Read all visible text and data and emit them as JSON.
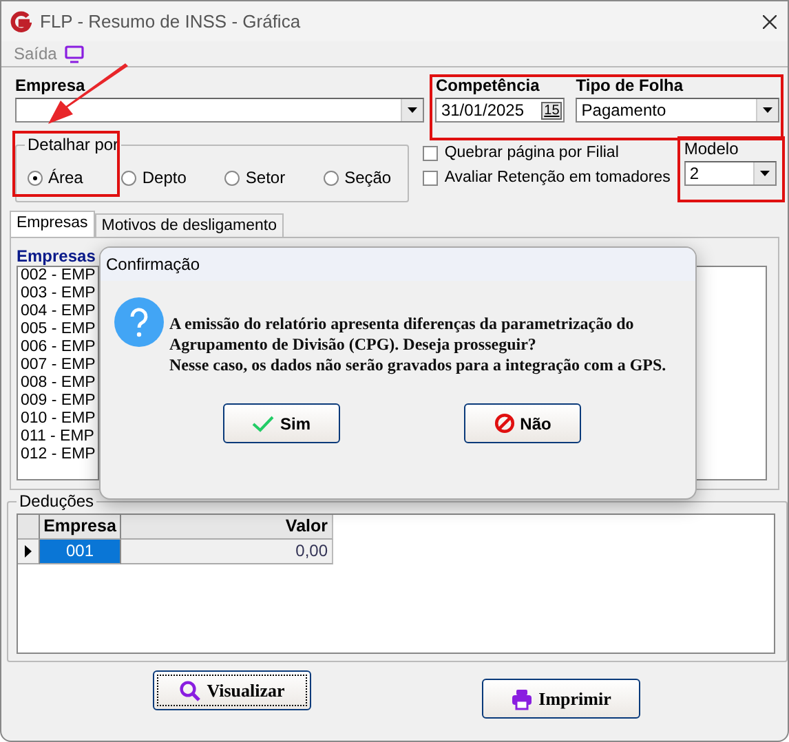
{
  "window": {
    "title": "FLP - Resumo de INSS - Gráfica"
  },
  "menu": [
    {
      "label": "Saída"
    }
  ],
  "empresa": {
    "label": "Empresa"
  },
  "competencia": {
    "label": "Competência",
    "value": "31/01/2025",
    "button": "15"
  },
  "tipo_folha": {
    "label": "Tipo de Folha",
    "value": "Pagamento"
  },
  "detalhar": {
    "label": "Detalhar por",
    "options": [
      {
        "label": "Área",
        "selected": true
      },
      {
        "label": "Depto",
        "selected": false
      },
      {
        "label": "Setor",
        "selected": false
      },
      {
        "label": "Seção",
        "selected": false
      }
    ]
  },
  "checkboxes": [
    {
      "label": "Quebrar página por Filial",
      "checked": false
    },
    {
      "label": "Avaliar Retenção em tomadores",
      "checked": false
    }
  ],
  "modelo": {
    "label": "Modelo",
    "value": "2"
  },
  "tabs": [
    {
      "label": "Empresas",
      "selected": true
    },
    {
      "label": "Motivos de desligamento",
      "selected": false
    }
  ],
  "empresas_list": {
    "label": "Empresas",
    "items": [
      "002 - EMP",
      "003 - EMP",
      "004 - EMP",
      "005 - EMP",
      "006 - EMP",
      "007 - EMP",
      "008 - EMP",
      "009 - EMP",
      "010 - EMP",
      "011 - EMP",
      "012 - EMP"
    ]
  },
  "deducoes": {
    "label": "Deduções",
    "columns": [
      "Empresa",
      "Valor"
    ],
    "rows": [
      {
        "empresa": "001",
        "valor": "0,00",
        "selected": true
      }
    ]
  },
  "buttons": [
    {
      "label": "Visualizar",
      "kind": "search"
    },
    {
      "label": "Imprimir",
      "kind": "print"
    }
  ],
  "dialog": {
    "title": "Confirmação",
    "message": [
      "A emissão do relatório apresenta diferenças da parametrização do Agrupamento de Divisão (CPG). Deseja prosseguir?",
      "Nesse caso, os dados não serão gravados para a integração com a GPS."
    ],
    "buttons": [
      {
        "label": "Sim",
        "kind": "yes"
      },
      {
        "label": "Não",
        "kind": "no"
      }
    ]
  }
}
